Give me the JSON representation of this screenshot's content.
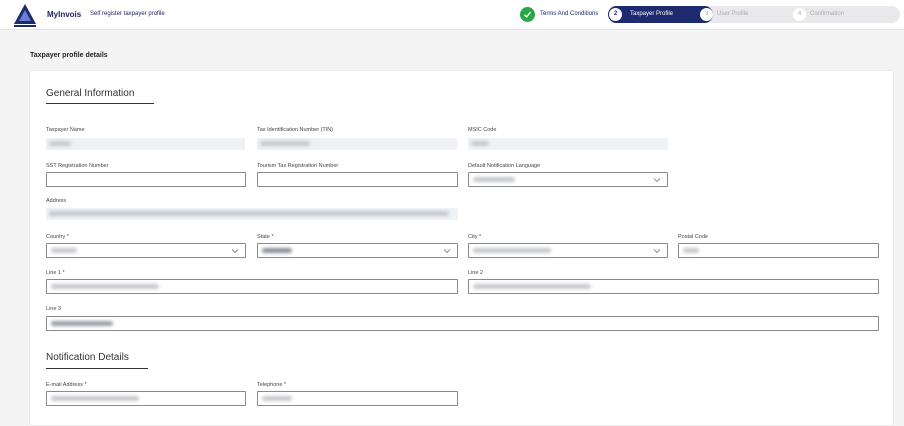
{
  "header": {
    "brand": "MyInvois",
    "subtitle": "Self register taxpayer profile"
  },
  "stepper": {
    "steps": [
      {
        "number": "",
        "label": "Terms And Conditions",
        "state": "done"
      },
      {
        "number": "2",
        "label": "Taxpayer Profile",
        "state": "active"
      },
      {
        "number": "3",
        "label": "User Profile",
        "state": "pending"
      },
      {
        "number": "4",
        "label": "Confirmation",
        "state": "pending"
      }
    ]
  },
  "page_title": "Taxpayer profile details",
  "general": {
    "title": "General Information",
    "taxpayer_name_label": "Taxpayer Name",
    "tin_label": "Tax Identification Number (TIN)",
    "msic_label": "MSIC Code",
    "sst_label": "SST Registration Number",
    "tourism_label": "Tourism Tax Registration Number",
    "language_label": "Default Notification Language",
    "address_label": "Address",
    "country_label": "Country *",
    "state_label": "State *",
    "city_label": "City *",
    "postal_label": "Postal Code",
    "line1_label": "Line 1 *",
    "line2_label": "Line 2",
    "line3_label": "Line 3"
  },
  "notification": {
    "title": "Notification Details",
    "email_label": "E-mail Address *",
    "phone_label": "Telephone *"
  },
  "colors": {
    "primary": "#1e2a6e",
    "success": "#27a844",
    "readonly_bg": "#eef2f7"
  }
}
